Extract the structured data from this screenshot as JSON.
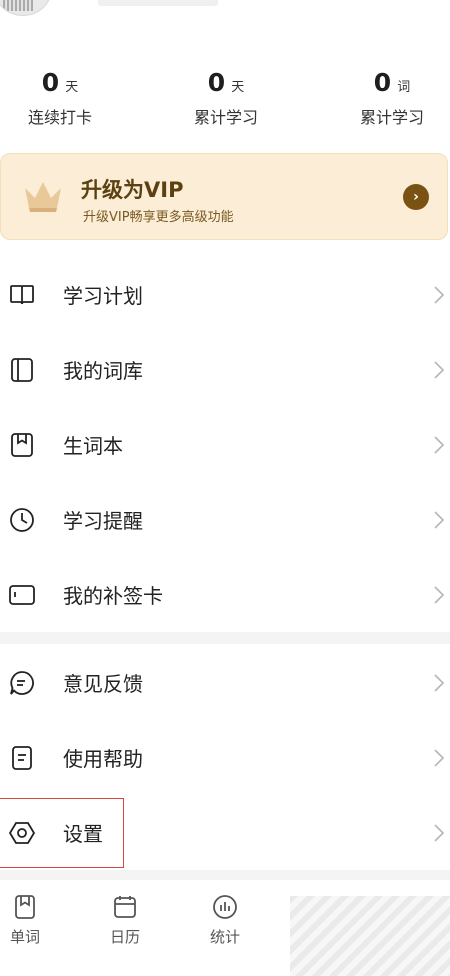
{
  "stats": [
    {
      "value": "0",
      "unit": "天",
      "label": "连续打卡"
    },
    {
      "value": "0",
      "unit": "天",
      "label": "累计学习"
    },
    {
      "value": "0",
      "unit": "词",
      "label": "累计学习"
    }
  ],
  "vip": {
    "title": "升级为VIP",
    "subtitle": "升级VIP畅享更多高级功能",
    "arrow": "›"
  },
  "menu_group1": [
    {
      "label": "学习计划",
      "icon": "book-open-icon"
    },
    {
      "label": "我的词库",
      "icon": "wordbank-icon"
    },
    {
      "label": "生词本",
      "icon": "notebook-icon"
    },
    {
      "label": "学习提醒",
      "icon": "clock-icon"
    },
    {
      "label": "我的补签卡",
      "icon": "card-icon"
    }
  ],
  "menu_group2": [
    {
      "label": "意见反馈",
      "icon": "chat-bubble-icon"
    },
    {
      "label": "使用帮助",
      "icon": "help-doc-icon"
    },
    {
      "label": "设置",
      "icon": "hexagon-settings-icon"
    }
  ],
  "tabs": [
    {
      "label": "单词",
      "icon": "book-tab-icon"
    },
    {
      "label": "日历",
      "icon": "calendar-icon"
    },
    {
      "label": "统计",
      "icon": "chart-icon"
    }
  ],
  "colors": {
    "vip_bg": "#fbedd6",
    "vip_title": "#5b4112",
    "highlight_border": "#d9463e"
  }
}
